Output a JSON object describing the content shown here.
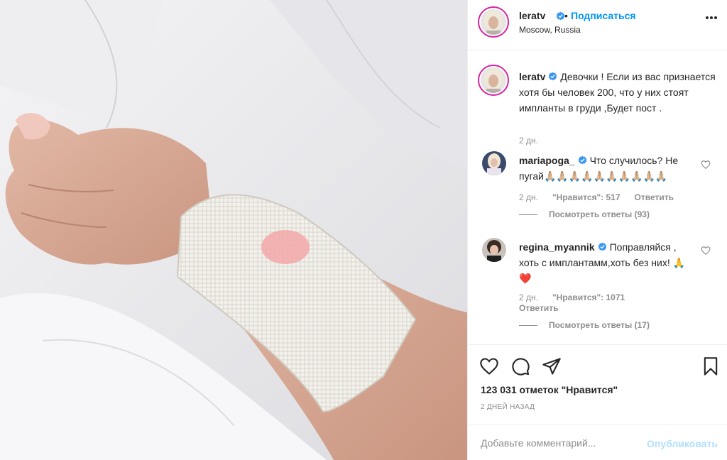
{
  "post": {
    "username": "leratv",
    "follow_label": "Подписаться",
    "dot": "•",
    "location": "Moscow, Russia",
    "caption": "Девочки ! Если из вас признается хотя бы человек 200, что у них стоят импланты в груди ,Будет пост .",
    "caption_time": "2 дн.",
    "likes_text": "123 031 отметок \"Нравится\"",
    "date_text": "2 ДНЕЙ НАЗАД"
  },
  "comments": [
    {
      "username": "mariapoga_",
      "text": "Что случилось? Не пугай🙏🏼🙏🏼🙏🏼🙏🏼🙏🏼🙏🏼🙏🏼🙏🏼🙏🏼🙏🏼",
      "time": "2 дн.",
      "likes": "\"Нравится\": 517",
      "reply": "Ответить",
      "view_replies": "Посмотреть ответы (93)"
    },
    {
      "username": "regina_myannik",
      "text": "Поправляйся , хоть с имплантамм,хоть без них! 🙏❤️",
      "time": "2 дн.",
      "likes": "\"Нравится\": 1071",
      "reply": "Ответить",
      "view_replies": "Посмотреть ответы (17)"
    }
  ],
  "comment_input": {
    "placeholder": "Добавьте комментарий...",
    "post_label": "Опубликовать"
  },
  "icons": {
    "more": "more-horizontal-icon",
    "like": "heart-icon",
    "comment": "comment-icon",
    "share": "share-icon",
    "save": "bookmark-icon",
    "verified": "verified-badge-icon"
  },
  "colors": {
    "accent": "#0095f6",
    "post_disabled": "#b2dffc",
    "muted": "#8e8e8e",
    "text": "#262626",
    "verified": "#3897f0",
    "avatar_ring": "#d6249f"
  }
}
